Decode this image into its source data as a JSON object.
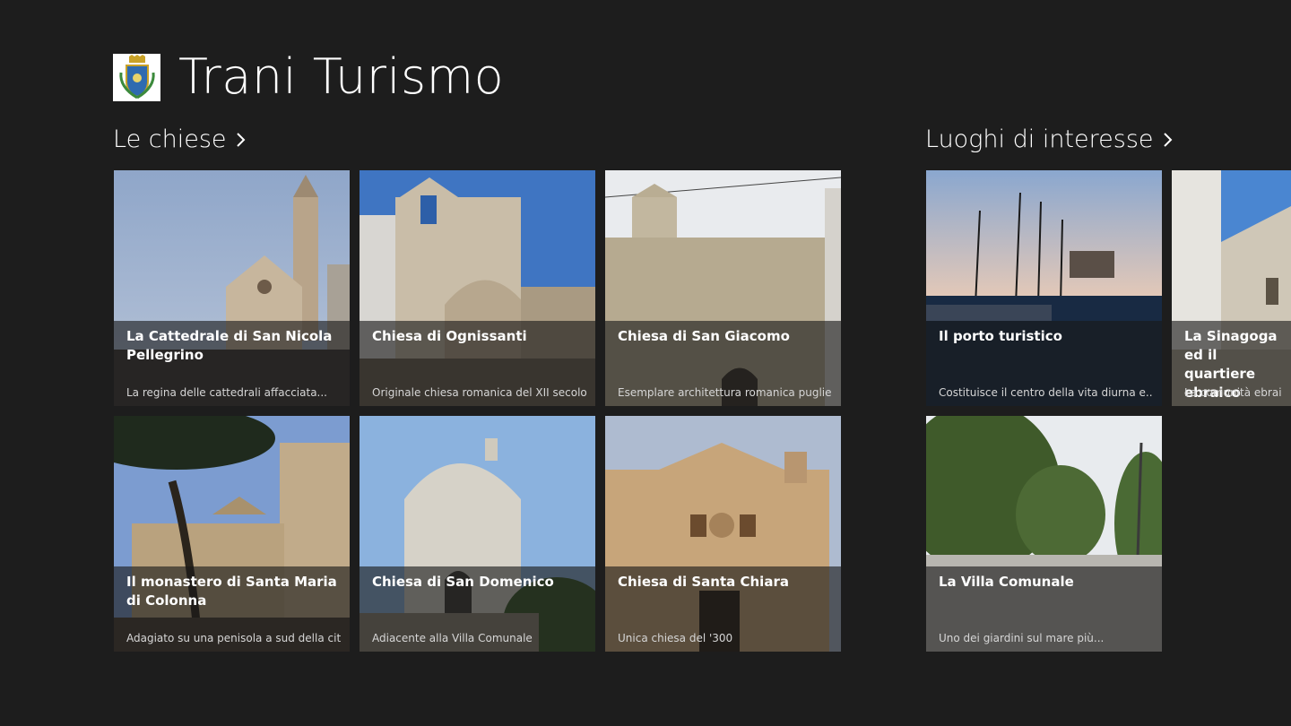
{
  "app": {
    "title": "Trani Turismo"
  },
  "colors": {
    "background": "#1d1d1d",
    "text": "#ffffff",
    "overlay": "rgba(25,25,25,0.62)"
  },
  "sections": [
    {
      "title": "Le chiese",
      "items": [
        {
          "title": "La Cattedrale di San Nicola Pellegrino",
          "subtitle": "La regina delle cattedrali affacciata..."
        },
        {
          "title": "Chiesa di Ognissanti",
          "subtitle": "Originale chiesa romanica del XII secolo"
        },
        {
          "title": "Chiesa di San Giacomo",
          "subtitle": "Esemplare architettura romanica pugliese"
        },
        {
          "title": "Il monastero di Santa Maria di Colonna",
          "subtitle": "Adagiato su una penisola a sud della città"
        },
        {
          "title": "Chiesa di San Domenico",
          "subtitle": "Adiacente alla Villa Comunale"
        },
        {
          "title": "Chiesa di Santa Chiara",
          "subtitle": "Unica chiesa del '300"
        }
      ]
    },
    {
      "title": "Luoghi di interesse",
      "items": [
        {
          "title": "Il porto turistico",
          "subtitle": "Costituisce il centro della vita diurna e..."
        },
        {
          "title": "La Sinagoga ed il quartiere ebraico",
          "subtitle": "La comunità ebraica di Trani..."
        },
        {
          "title": "La Villa Comunale",
          "subtitle": "Uno dei giardini sul mare più..."
        }
      ]
    }
  ]
}
